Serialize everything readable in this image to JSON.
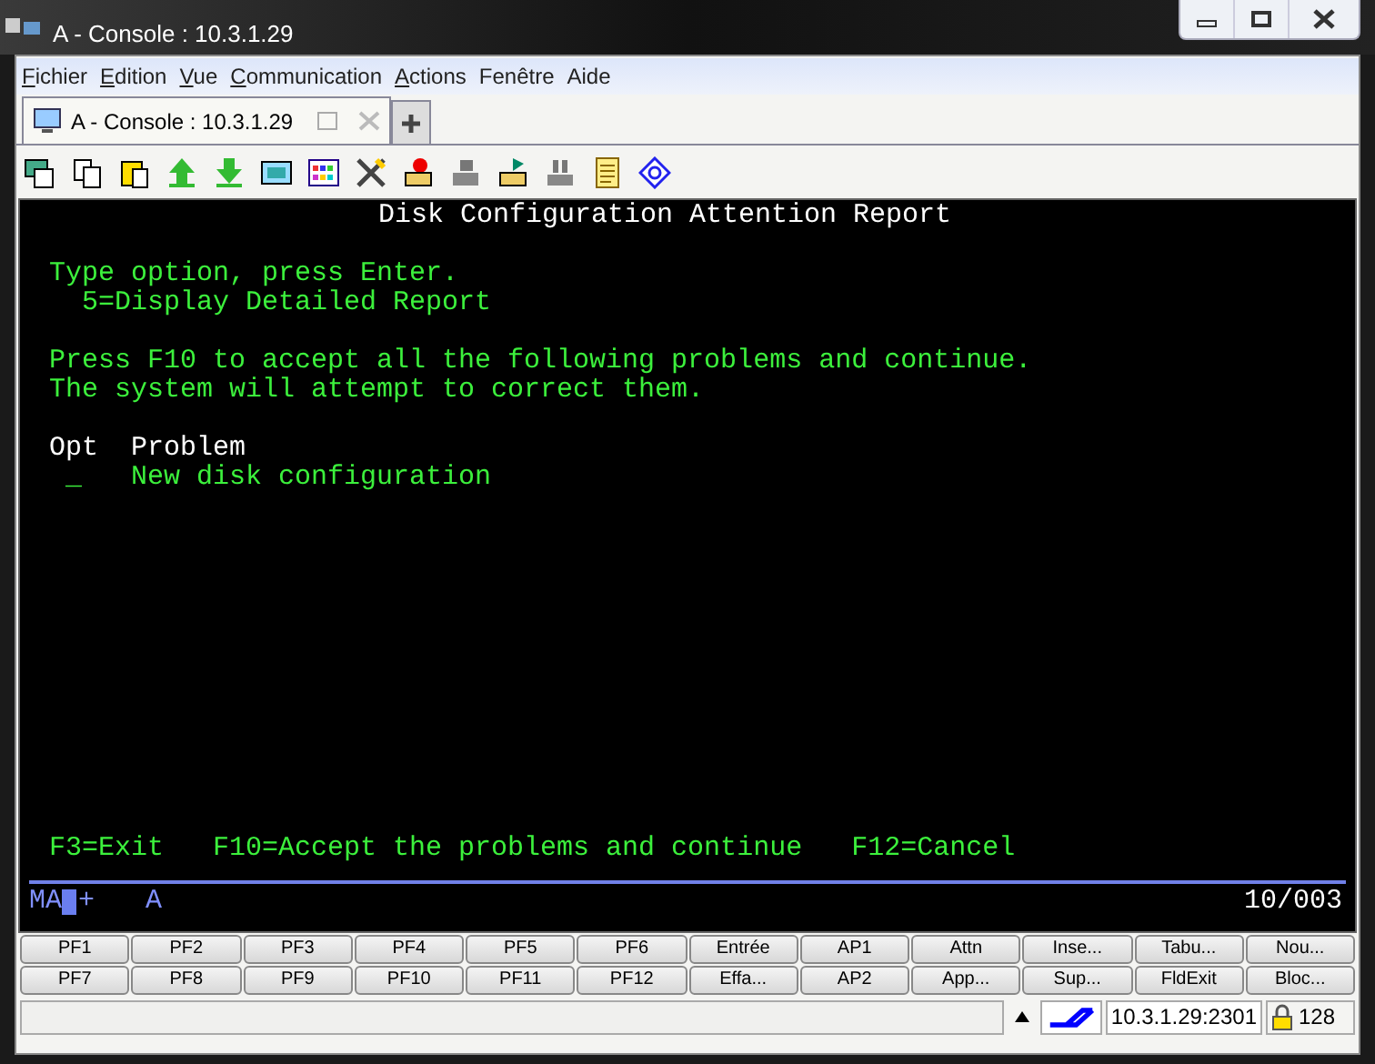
{
  "window": {
    "title": "A - Console : 10.3.1.29"
  },
  "menu": [
    {
      "label": "Fichier",
      "mnemonic": true
    },
    {
      "label": "Edition",
      "mnemonic": true
    },
    {
      "label": "Vue",
      "mnemonic": true
    },
    {
      "label": "Communication",
      "mnemonic": true
    },
    {
      "label": "Actions",
      "mnemonic": true
    },
    {
      "label": "Fenêtre",
      "mnemonic": false
    },
    {
      "label": "Aide",
      "mnemonic": false
    }
  ],
  "tabs": [
    {
      "label": "A - Console : 10.3.1.29",
      "selected": true
    }
  ],
  "terminal": {
    "title": "Disk Configuration Attention Report",
    "instructions": [
      "Type option, press Enter.",
      "5=Display Detailed Report"
    ],
    "messages": [
      "Press F10 to accept all the following problems and continue.",
      "The system will attempt to correct them."
    ],
    "columns": [
      "Opt",
      "Problem"
    ],
    "rows": [
      {
        "option": "_",
        "problem": "New disk configuration"
      }
    ],
    "function_keys": [
      "F3=Exit",
      "F10=Accept the problems and continue",
      "F12=Cancel"
    ],
    "oia": {
      "mode": "MA",
      "flag": "+",
      "indicator": "A",
      "position": "10/003"
    }
  },
  "keypad": [
    "PF1",
    "PF2",
    "PF3",
    "PF4",
    "PF5",
    "PF6",
    "Entrée",
    "AP1",
    "Attn",
    "Inse...",
    "Tabu...",
    "Nou...",
    "PF7",
    "PF8",
    "PF9",
    "PF10",
    "PF11",
    "PF12",
    "Effa...",
    "AP2",
    "App...",
    "Sup...",
    "FldExit",
    "Bloc..."
  ],
  "status_bar": {
    "address": "10.3.1.29:2301",
    "key_size": "128"
  }
}
